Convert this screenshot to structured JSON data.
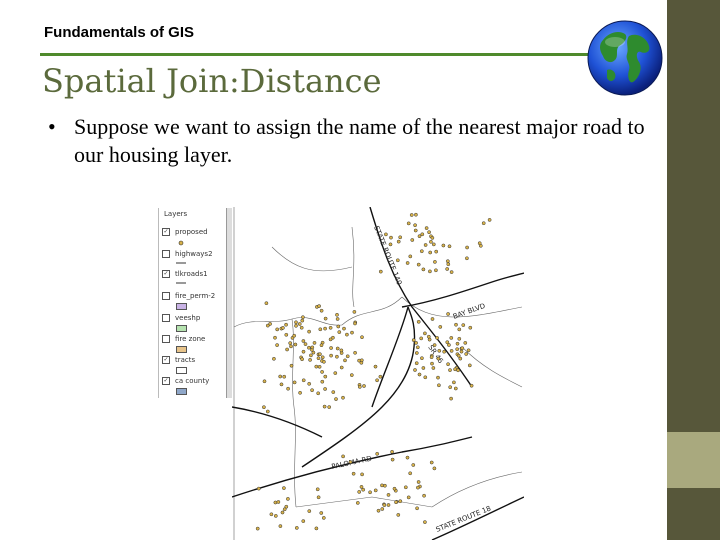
{
  "header": {
    "label": "Fundamentals of GIS"
  },
  "slide": {
    "title": "Spatial Join:Distance",
    "bullet_char": "•",
    "bullet_text": "Suppose we want to assign the name of the nearest major road to our housing layer."
  },
  "legend": {
    "title": "Layers",
    "items": [
      {
        "label": "proposed",
        "checked": true
      },
      {
        "label": "highways2",
        "checked": false
      },
      {
        "label": "tlkroads1",
        "checked": true
      },
      {
        "label": "fire_perm-2",
        "checked": false
      },
      {
        "label": "veeshp",
        "checked": false
      },
      {
        "label": "fire zone",
        "checked": false
      },
      {
        "label": "tracts",
        "checked": true
      },
      {
        "label": "ca county",
        "checked": true
      }
    ]
  },
  "map": {
    "road_labels": [
      "STATE ROUTE 140",
      "BAY BLVD",
      "SR 46",
      "PALOMA RD",
      "STATE ROUTE 18"
    ]
  },
  "colors": {
    "accent_green": "#4f8a2c",
    "title_olive": "#5b6a3c",
    "sidebar_dark": "#57573a",
    "sidebar_light": "#a9a97e",
    "house_fill": "#d8b24a"
  }
}
